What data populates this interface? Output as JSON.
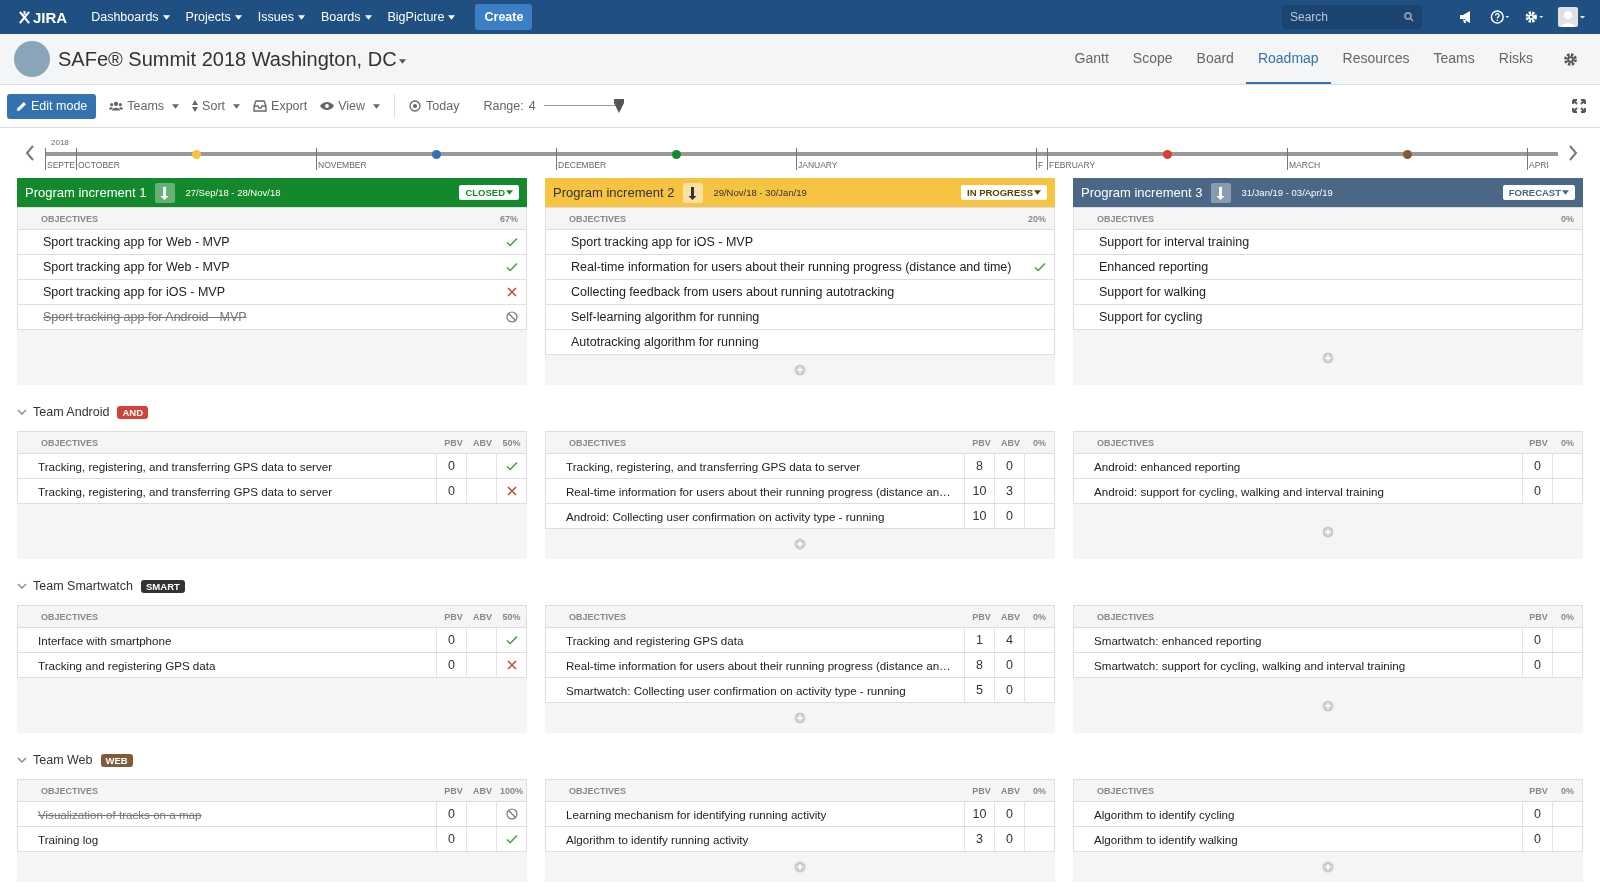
{
  "topnav": {
    "logo": "JIRA",
    "menus": [
      "Dashboards",
      "Projects",
      "Issues",
      "Boards",
      "BigPicture"
    ],
    "create": "Create",
    "search": {
      "placeholder": "Search"
    }
  },
  "project": {
    "title": "SAFe® Summit 2018 Washington, DC",
    "tabs": [
      {
        "label": "Gantt",
        "selected": false
      },
      {
        "label": "Scope",
        "selected": false
      },
      {
        "label": "Board",
        "selected": false
      },
      {
        "label": "Roadmap",
        "selected": true
      },
      {
        "label": "Resources",
        "selected": false
      },
      {
        "label": "Teams",
        "selected": false
      },
      {
        "label": "Risks",
        "selected": false
      }
    ]
  },
  "toolbar": {
    "edit": "Edit mode",
    "menus": [
      "Teams",
      "Sort",
      "Export",
      "View"
    ],
    "today": "Today",
    "range_label": "Range:",
    "range_value": "4",
    "range": {
      "level": 1
    }
  },
  "timeline": {
    "year": "2018",
    "months": [
      {
        "label": "SEPTE",
        "kind": "partial"
      },
      {
        "label": "OCTOBER",
        "kind": "full",
        "markers": [
          {
            "color": "#f6c342"
          }
        ]
      },
      {
        "label": "NOVEMBER",
        "kind": "full",
        "markers": [
          {
            "color": "#3572b0"
          }
        ]
      },
      {
        "label": "DECEMBER",
        "kind": "full",
        "markers": [
          {
            "color": "#14892c"
          }
        ]
      },
      {
        "label": "JANUARY",
        "kind": "full"
      },
      {
        "label": "F",
        "kind": "partial"
      },
      {
        "label": "FEBRUARY",
        "kind": "full",
        "markers": [
          {
            "color": "#d04437"
          }
        ]
      },
      {
        "label": "MARCH",
        "kind": "full",
        "markers": [
          {
            "color": "#815b3a"
          }
        ]
      },
      {
        "label": "APRI",
        "kind": "partial"
      }
    ]
  },
  "increments": [
    {
      "title": "Program increment 1",
      "dates": "27/Sep/18 - 28/Nov/18",
      "status": "CLOSED",
      "color": "#14892c",
      "objectives_label": "OBJECTIVES",
      "percent": "67%",
      "can_add": false,
      "objectives": [
        {
          "text": "Sport tracking app for Web - MVP",
          "kind": "done"
        },
        {
          "text": "Sport tracking app for Web - MVP",
          "kind": "done"
        },
        {
          "text": "Sport tracking app for iOS - MVP",
          "kind": "failed"
        },
        {
          "text": "Sport tracking app for Android - MVP",
          "kind": "cancelled"
        }
      ]
    },
    {
      "title": "Program increment 2",
      "dates": "29/Nov/18 - 30/Jan/19",
      "status": "IN PROGRESS",
      "color": "#f6c342",
      "objectives_label": "OBJECTIVES",
      "percent": "20%",
      "can_add": true,
      "objectives": [
        {
          "text": "Sport tracking app for iOS - MVP",
          "kind": "open"
        },
        {
          "text": "Real-time information for users about their running progress (distance and time)",
          "kind": "done"
        },
        {
          "text": "Collecting feedback from users about running autotracking",
          "kind": "open"
        },
        {
          "text": "Self-learning algorithm for running",
          "kind": "open"
        },
        {
          "text": "Autotracking algorithm for running",
          "kind": "open"
        }
      ]
    },
    {
      "title": "Program increment 3",
      "dates": "31/Jan/19 - 03/Apr/19",
      "status": "FORECAST",
      "color": "#4a6785",
      "objectives_label": "OBJECTIVES",
      "percent": "0%",
      "can_add": true,
      "objectives": [
        {
          "text": "Support for interval training",
          "kind": "open"
        },
        {
          "text": "Enhanced reporting",
          "kind": "open"
        },
        {
          "text": "Support for walking",
          "kind": "open"
        },
        {
          "text": "Support for cycling",
          "kind": "open"
        }
      ]
    }
  ],
  "teams": [
    {
      "name": "Team Android",
      "badge": "AND",
      "color": "#d04437",
      "expanded": true,
      "panels": [
        {
          "objectives_label": "OBJECTIVES",
          "columns": [
            "PBV",
            "ABV"
          ],
          "percent": "50%",
          "can_add": false,
          "rows": [
            {
              "text": "Tracking, registering, and transferring GPS data to server",
              "pbv": "0",
              "kind": "done"
            },
            {
              "text": "Tracking, registering, and transferring GPS data to server",
              "pbv": "0",
              "kind": "failed"
            }
          ]
        },
        {
          "objectives_label": "OBJECTIVES",
          "columns": [
            "PBV",
            "ABV"
          ],
          "percent": "0%",
          "can_add": true,
          "rows": [
            {
              "text": "Tracking, registering, and transferring GPS data to server",
              "pbv": "8",
              "abv": "0",
              "kind": "open"
            },
            {
              "text": "Real-time information for users about their running progress (distance an…",
              "pbv": "10",
              "abv": "3",
              "kind": "open"
            },
            {
              "text": "Android: Collecting user confirmation on activity type - running",
              "pbv": "10",
              "abv": "0",
              "kind": "open"
            }
          ]
        },
        {
          "objectives_label": "OBJECTIVES",
          "columns": [
            "PBV"
          ],
          "percent": "0%",
          "can_add": true,
          "rows": [
            {
              "text": "Android: enhanced reporting",
              "pbv": "0",
              "kind": "open"
            },
            {
              "text": "Android: support for cycling, walking and interval training",
              "pbv": "0",
              "kind": "open"
            }
          ]
        }
      ]
    },
    {
      "name": "Team Smartwatch",
      "badge": "SMART",
      "color": "#333333",
      "expanded": true,
      "panels": [
        {
          "objectives_label": "OBJECTIVES",
          "columns": [
            "PBV",
            "ABV"
          ],
          "percent": "50%",
          "can_add": false,
          "rows": [
            {
              "text": "Interface with smartphone",
              "pbv": "0",
              "kind": "done"
            },
            {
              "text": "Tracking and registering GPS data",
              "pbv": "0",
              "kind": "failed"
            }
          ]
        },
        {
          "objectives_label": "OBJECTIVES",
          "columns": [
            "PBV",
            "ABV"
          ],
          "percent": "0%",
          "can_add": true,
          "rows": [
            {
              "text": "Tracking and registering GPS data",
              "pbv": "1",
              "abv": "4",
              "kind": "open"
            },
            {
              "text": "Real-time information for users about their running progress (distance an…",
              "pbv": "8",
              "abv": "0",
              "kind": "open"
            },
            {
              "text": "Smartwatch: Collecting user confirmation on activity type - running",
              "pbv": "5",
              "abv": "0",
              "kind": "open"
            }
          ]
        },
        {
          "objectives_label": "OBJECTIVES",
          "columns": [
            "PBV"
          ],
          "percent": "0%",
          "can_add": true,
          "rows": [
            {
              "text": "Smartwatch: enhanced reporting",
              "pbv": "0",
              "kind": "open"
            },
            {
              "text": "Smartwatch: support for cycling, walking and interval training",
              "pbv": "0",
              "kind": "open"
            }
          ]
        }
      ]
    },
    {
      "name": "Team Web",
      "badge": "WEB",
      "color": "#815b3a",
      "expanded": true,
      "panels": [
        {
          "objectives_label": "OBJECTIVES",
          "columns": [
            "PBV",
            "ABV"
          ],
          "percent": "100%",
          "can_add": false,
          "rows": [
            {
              "text": "Visualization of tracks on a map",
              "pbv": "0",
              "kind": "cancelled"
            },
            {
              "text": "Training log",
              "pbv": "0",
              "kind": "done"
            }
          ]
        },
        {
          "objectives_label": "OBJECTIVES",
          "columns": [
            "PBV",
            "ABV"
          ],
          "percent": "0%",
          "can_add": true,
          "rows": [
            {
              "text": "Learning mechanism for identifying running activity",
              "pbv": "10",
              "abv": "0",
              "kind": "open"
            },
            {
              "text": "Algorithm to identify running activity",
              "pbv": "3",
              "abv": "0",
              "kind": "open"
            }
          ]
        },
        {
          "objectives_label": "OBJECTIVES",
          "columns": [
            "PBV"
          ],
          "percent": "0%",
          "can_add": true,
          "rows": [
            {
              "text": "Algorithm to identify cycling",
              "pbv": "0",
              "kind": "open"
            },
            {
              "text": "Algorithm to identify walking",
              "pbv": "0",
              "kind": "open"
            }
          ]
        }
      ]
    }
  ]
}
